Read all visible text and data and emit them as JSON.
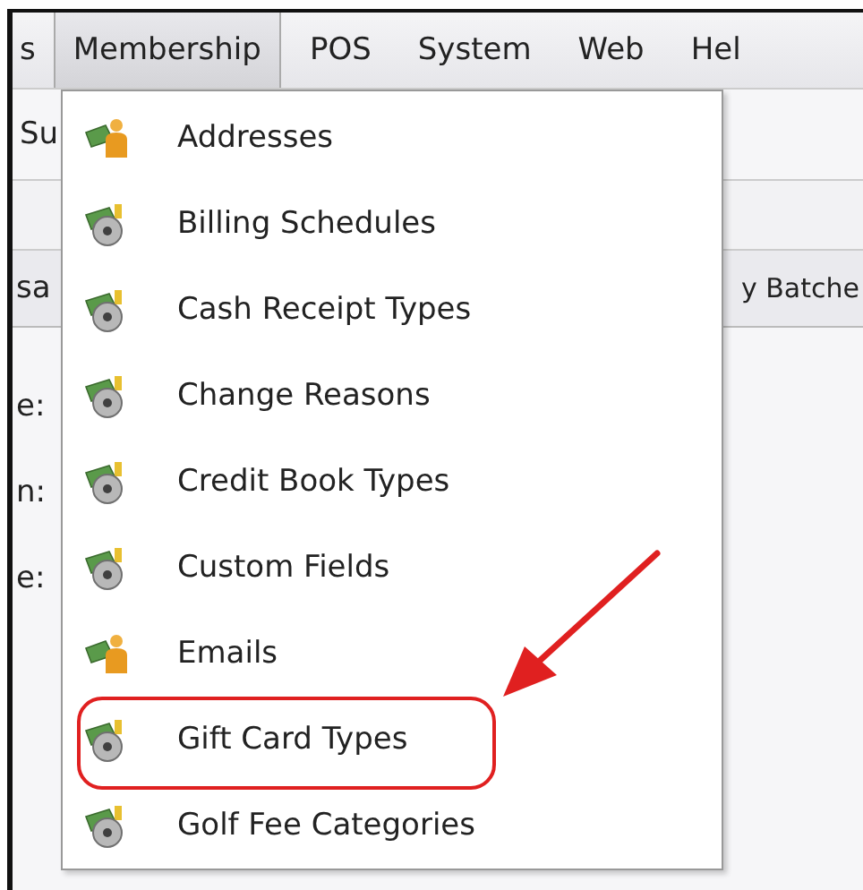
{
  "menubar": [
    {
      "label": "s",
      "selected": false
    },
    {
      "label": "Membership",
      "selected": true
    },
    {
      "label": "POS",
      "selected": false
    },
    {
      "label": "System",
      "selected": false
    },
    {
      "label": "Web",
      "selected": false
    },
    {
      "label": "Hel",
      "selected": false
    }
  ],
  "toolbar_fragment": "Su",
  "tab_fragments": [
    "sa",
    "y Batche"
  ],
  "form_label_fragments": [
    "e:",
    "n:",
    "e:"
  ],
  "menu": {
    "items": [
      {
        "label": "Addresses",
        "kind": "person",
        "highlighted": false
      },
      {
        "label": "Billing Schedules",
        "kind": "disc",
        "highlighted": false
      },
      {
        "label": "Cash Receipt Types",
        "kind": "disc",
        "highlighted": false
      },
      {
        "label": "Change Reasons",
        "kind": "disc",
        "highlighted": false
      },
      {
        "label": "Credit Book Types",
        "kind": "disc",
        "highlighted": false
      },
      {
        "label": "Custom Fields",
        "kind": "disc",
        "highlighted": false
      },
      {
        "label": "Emails",
        "kind": "person",
        "highlighted": false
      },
      {
        "label": "Gift Card Types",
        "kind": "disc",
        "highlighted": true
      },
      {
        "label": "Golf Fee Categories",
        "kind": "disc",
        "highlighted": false
      }
    ]
  }
}
